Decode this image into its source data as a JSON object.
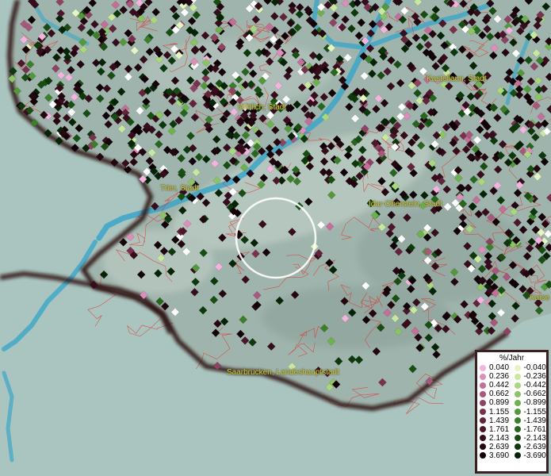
{
  "places": [
    {
      "id": "wittlich",
      "label": "Wittlich, Stadt"
    },
    {
      "id": "kastellaun",
      "label": "Kastellaun, Stadt"
    },
    {
      "id": "trier",
      "label": "Trier, Stadt"
    },
    {
      "id": "idar",
      "label": "Idar-Oberstein, Stadt"
    },
    {
      "id": "kaise",
      "label": "Kaise"
    },
    {
      "id": "saarbruecken",
      "label": "Saarbrücken, Landeshauptstadt"
    }
  ],
  "legend": {
    "title": "%/Jahr",
    "rows": [
      {
        "pos": "0.040",
        "pos_color": "#f2b3dd",
        "neg": "-0.040",
        "neg_color": "#e4f5c2"
      },
      {
        "pos": "0.236",
        "pos_color": "#dc8fbb",
        "neg": "-0.236",
        "neg_color": "#c8e8a0"
      },
      {
        "pos": "0.442",
        "pos_color": "#c46f9a",
        "neg": "-0.442",
        "neg_color": "#a9d67f"
      },
      {
        "pos": "0.662",
        "pos_color": "#a8587c",
        "neg": "-0.662",
        "neg_color": "#8cc365"
      },
      {
        "pos": "0.899",
        "pos_color": "#8f4363",
        "neg": "-0.899",
        "neg_color": "#6fb04f"
      },
      {
        "pos": "1.155",
        "pos_color": "#78324e",
        "neg": "-1.155",
        "neg_color": "#53983b"
      },
      {
        "pos": "1.439",
        "pos_color": "#62233b",
        "neg": "-1.439",
        "neg_color": "#3c7f2b"
      },
      {
        "pos": "1.761",
        "pos_color": "#4c172b",
        "neg": "-1.761",
        "neg_color": "#28661e"
      },
      {
        "pos": "2.143",
        "pos_color": "#370d1d",
        "neg": "-2.143",
        "neg_color": "#194e13"
      },
      {
        "pos": "2.639",
        "pos_color": "#240611",
        "neg": "-2.639",
        "neg_color": "#0d380b"
      },
      {
        "pos": "3.690",
        "pos_color": "#120208",
        "neg": "-3.690",
        "neg_color": "#052405"
      }
    ]
  },
  "colors": {
    "land": "#9fb4ac",
    "outside": "#aac4bf",
    "water": "#3ba6c8",
    "border": "#2a1010",
    "districts": "#e0302a",
    "label": "#d6c53b"
  }
}
